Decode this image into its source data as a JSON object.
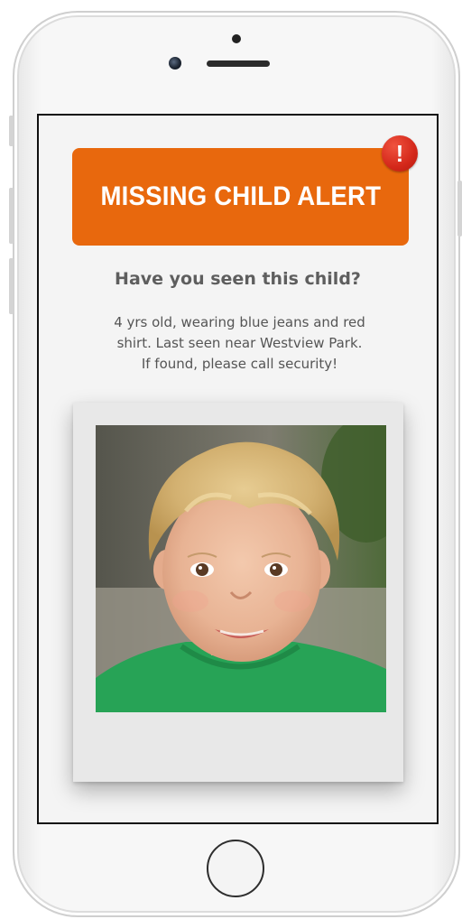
{
  "alert": {
    "title": "MISSING CHILD ALERT",
    "badge_symbol": "!",
    "banner_color": "#e8680d",
    "badge_color": "#d4281a"
  },
  "content": {
    "question": "Have you seen this child?",
    "description_lines": [
      "4 yrs old, wearing blue jeans and red",
      "shirt. Last seen near Westview Park.",
      "If found, please call security!"
    ]
  },
  "photo": {
    "icon": "child-portrait-photo"
  }
}
